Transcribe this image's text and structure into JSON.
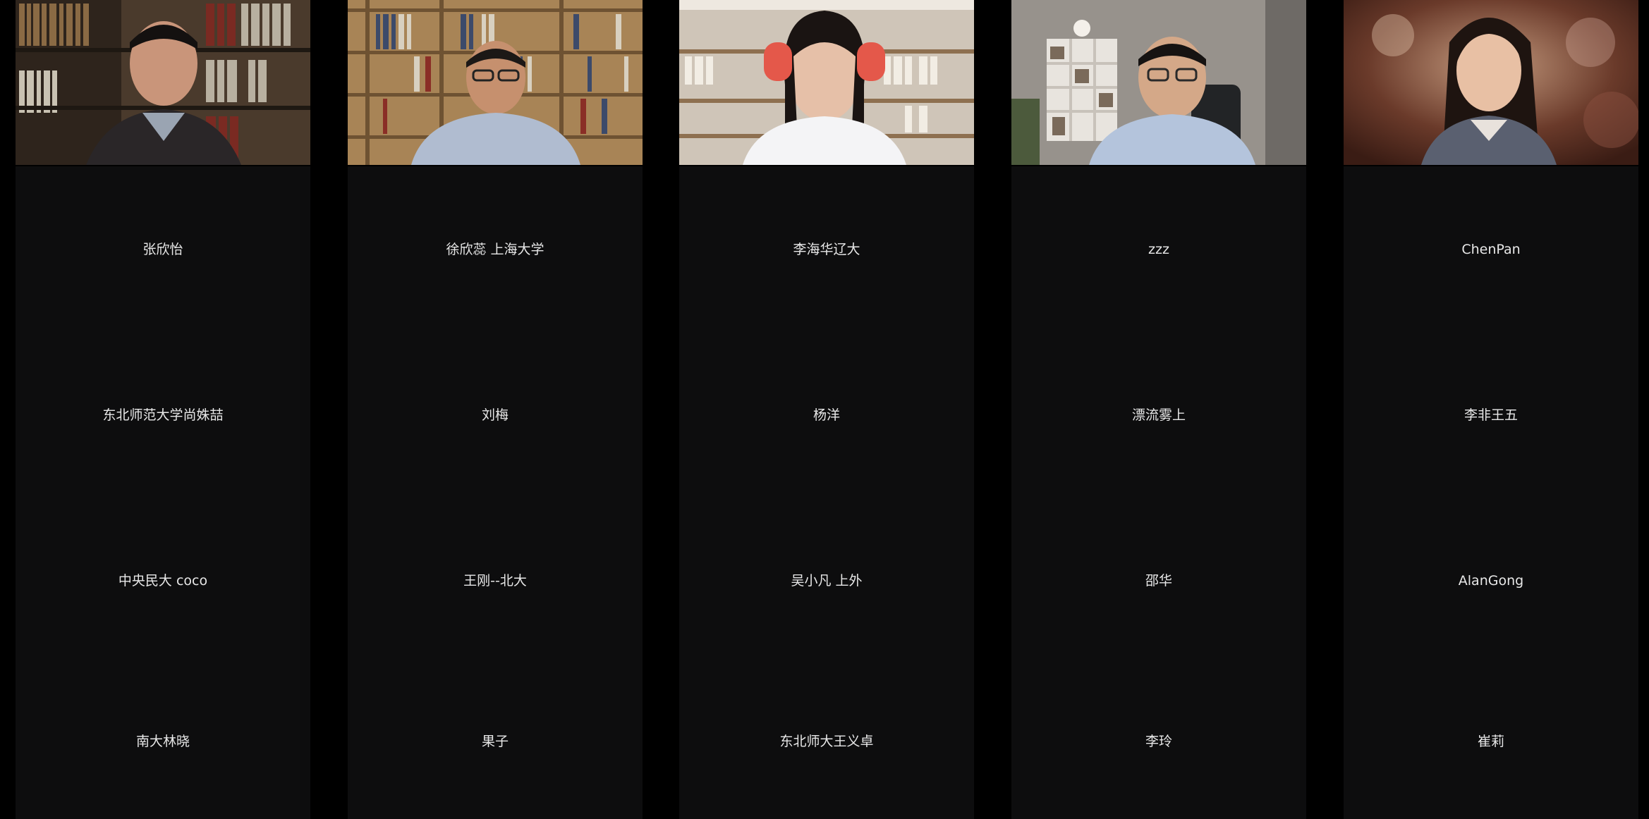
{
  "meeting": {
    "columns": [
      {
        "video_participant": "video-participant-1",
        "names": [
          "张欣怡",
          "东北师范大学尚姝喆",
          "中央民大 coco",
          "南大林晓"
        ]
      },
      {
        "video_participant": "video-participant-2",
        "names": [
          "徐欣蕊 上海大学",
          "刘梅",
          "王刚--北大",
          "果子"
        ]
      },
      {
        "video_participant": "video-participant-3",
        "names": [
          "李海华辽大",
          "杨洋",
          "吴小凡 上外",
          "东北师大王义卓"
        ]
      },
      {
        "video_participant": "video-participant-4",
        "names": [
          "zzz",
          "漂流雾上",
          "邵华",
          "李玲"
        ]
      },
      {
        "video_participant": "video-participant-5",
        "names": [
          "ChenPan",
          "李非王五",
          "AlanGong",
          "崔莉"
        ]
      }
    ]
  },
  "colors": {
    "background": "#000000",
    "tile": "#0d0d0e",
    "name_text": "#e8e8e8"
  }
}
